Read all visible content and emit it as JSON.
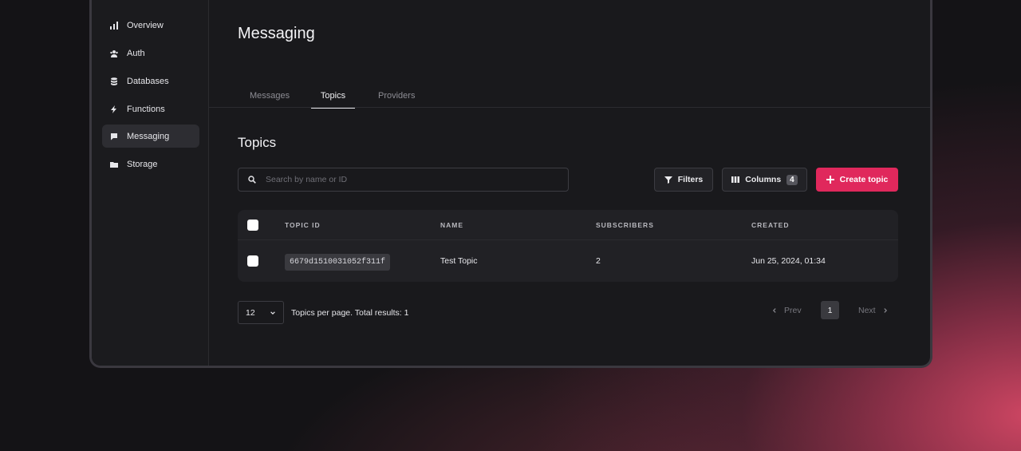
{
  "sidebar": {
    "items": [
      {
        "label": "Overview",
        "icon": "bar-chart-icon"
      },
      {
        "label": "Auth",
        "icon": "users-icon"
      },
      {
        "label": "Databases",
        "icon": "database-icon"
      },
      {
        "label": "Functions",
        "icon": "lightning-icon"
      },
      {
        "label": "Messaging",
        "icon": "chat-icon",
        "active": true
      },
      {
        "label": "Storage",
        "icon": "folder-icon"
      }
    ]
  },
  "page": {
    "title": "Messaging"
  },
  "tabs": [
    {
      "label": "Messages"
    },
    {
      "label": "Topics",
      "active": true
    },
    {
      "label": "Providers"
    }
  ],
  "section": {
    "title": "Topics"
  },
  "search": {
    "placeholder": "Search by name or ID",
    "value": ""
  },
  "toolbar": {
    "filters_label": "Filters",
    "columns_label": "Columns",
    "columns_count": "4",
    "create_label": "Create topic"
  },
  "table": {
    "headers": [
      "TOPIC ID",
      "NAME",
      "SUBSCRIBERS",
      "CREATED"
    ],
    "rows": [
      {
        "topic_id": "6679d1510031052f311f",
        "name": "Test Topic",
        "subscribers": "2",
        "created": "Jun 25, 2024, 01:34"
      }
    ]
  },
  "pagination": {
    "per_page": "12",
    "summary": "Topics per page. Total results: 1",
    "prev_label": "Prev",
    "next_label": "Next",
    "current_page": "1"
  },
  "colors": {
    "accent": "#e0285c",
    "background": "#19191c"
  }
}
